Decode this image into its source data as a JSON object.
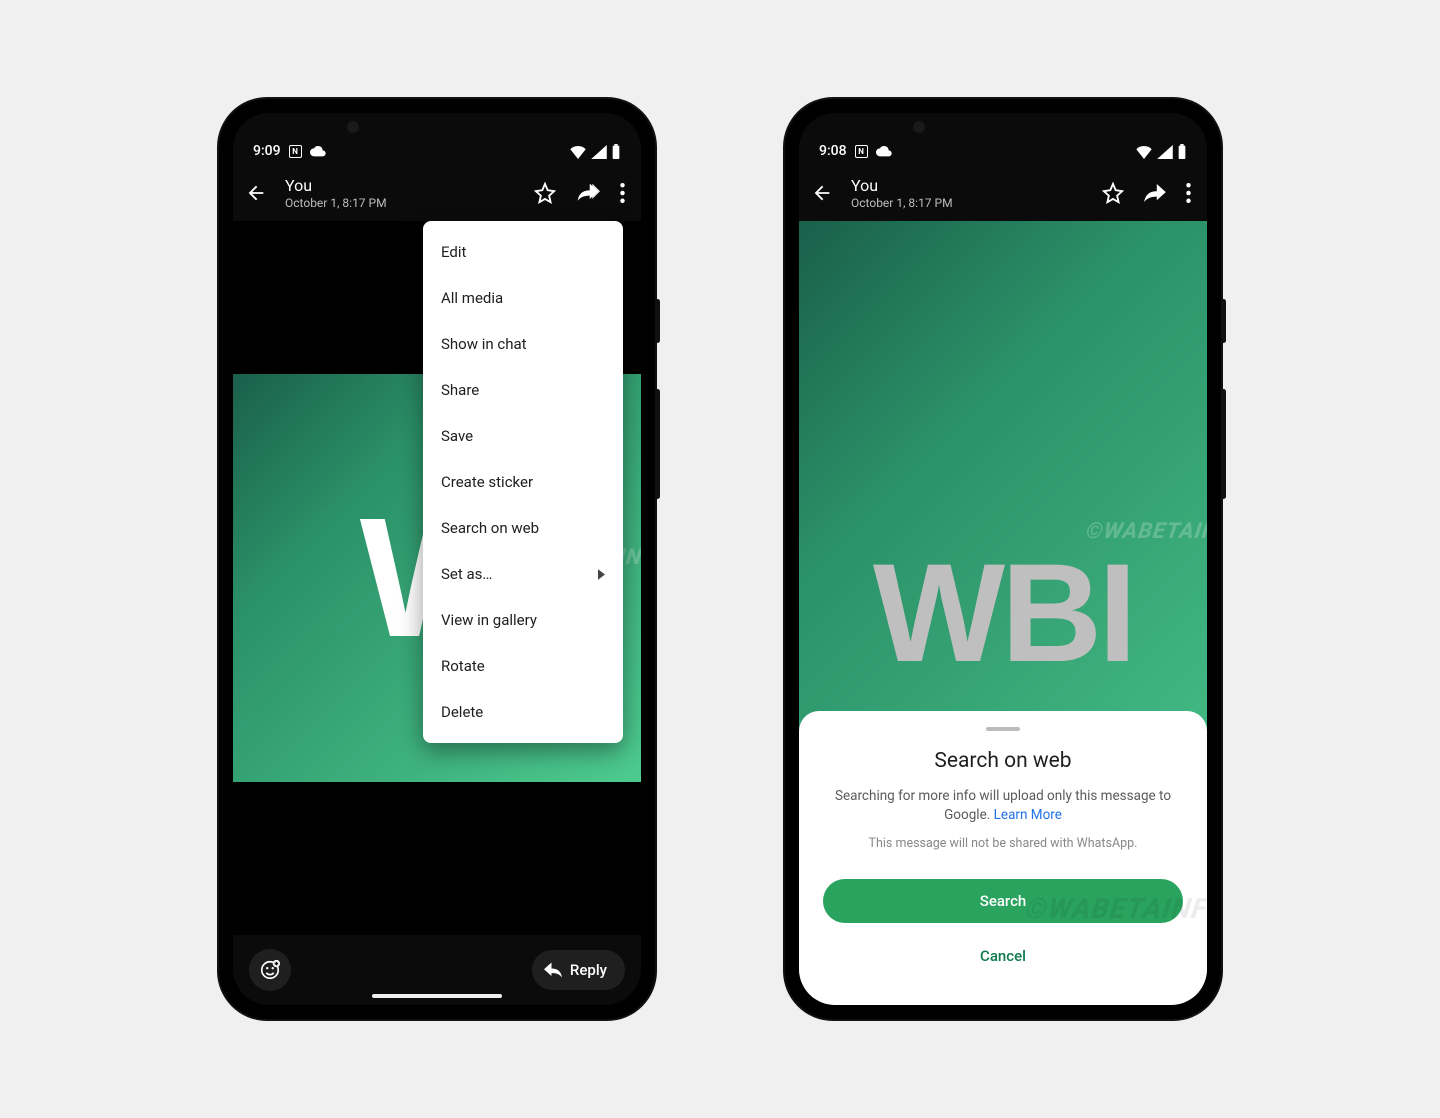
{
  "left_phone": {
    "status_time": "9:09",
    "header": {
      "title": "You",
      "subtitle": "October 1, 8:17 PM"
    },
    "menu": {
      "items": [
        {
          "label": "Edit",
          "submenu": false
        },
        {
          "label": "All media",
          "submenu": false
        },
        {
          "label": "Show in chat",
          "submenu": false
        },
        {
          "label": "Share",
          "submenu": false
        },
        {
          "label": "Save",
          "submenu": false
        },
        {
          "label": "Create sticker",
          "submenu": false
        },
        {
          "label": "Search on web",
          "submenu": false
        },
        {
          "label": "Set as…",
          "submenu": true
        },
        {
          "label": "View in gallery",
          "submenu": false
        },
        {
          "label": "Rotate",
          "submenu": false
        },
        {
          "label": "Delete",
          "submenu": false
        }
      ]
    },
    "reply_label": "Reply",
    "image_logo": "W",
    "watermark": "©WABETAINFO"
  },
  "right_phone": {
    "status_time": "9:08",
    "header": {
      "title": "You",
      "subtitle": "October 1, 8:17 PM"
    },
    "image_logo": "WBI",
    "sheet": {
      "title": "Search on web",
      "body_part1": "Searching for more info will upload only this message to Google. ",
      "learn_more": "Learn More",
      "note": "This message will not be shared with WhatsApp.",
      "primary": "Search",
      "secondary": "Cancel"
    },
    "watermark": "©WABETAINFO"
  }
}
